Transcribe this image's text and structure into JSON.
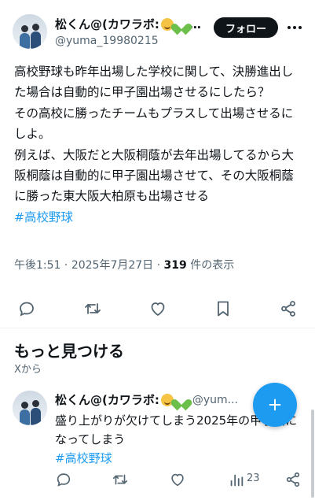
{
  "tweet": {
    "author": {
      "display_name": "松くん@(カワラボ:",
      "name_ellipsis": "…",
      "handle": "@yuma_19980215",
      "emojis": [
        "smiling-face-emoji",
        "green-heart-emoji"
      ]
    },
    "follow_label": "フォロー",
    "body_lines": [
      "高校野球も昨年出場した学校に関して、決勝進出した場合は自動的に甲子園出場させるにしたら？",
      "その高校に勝ったチームもプラスして出場させるにしよ。",
      "例えば、大阪だと大阪桐蔭が去年出場してるから大阪桐蔭は自動的に甲子園出場させて、その大阪桐蔭に勝った東大阪大柏原も出場させる"
    ],
    "hashtag": "#高校野球",
    "meta": {
      "time": "午後1:51",
      "date": "2025年7月27日",
      "separator": "·",
      "views": "319",
      "views_label": "件の表示"
    },
    "actions": [
      "reply-icon",
      "retweet-icon",
      "like-icon",
      "bookmark-icon",
      "share-icon"
    ]
  },
  "discover": {
    "title": "もっと見つける",
    "subtitle": "Xから"
  },
  "recommended": {
    "author": {
      "display_name": "松くん@(カワラボ:",
      "handle": "@yum..."
    },
    "body": "盛り上がりが欠けてしまう2025年の甲子園になってしまう",
    "hashtag": "#高校野球",
    "views_count": "23"
  },
  "colors": {
    "accent": "#1d9bf0",
    "text": "#0f1419",
    "secondary": "#536471",
    "follow_bg": "#0f1419"
  }
}
